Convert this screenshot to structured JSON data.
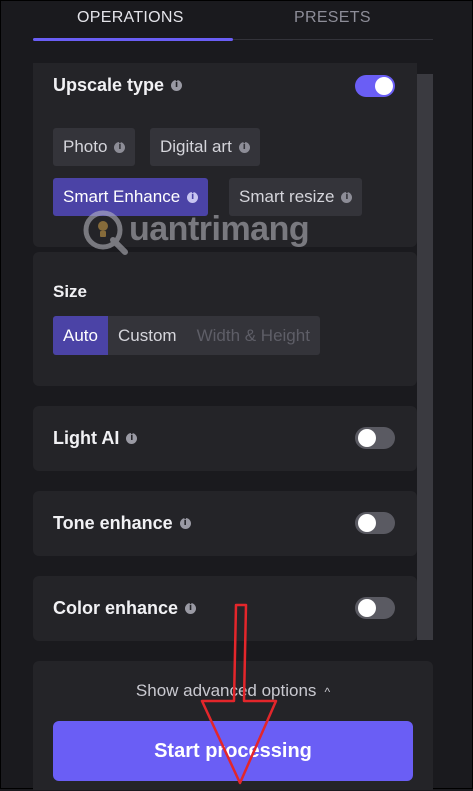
{
  "tabs": [
    {
      "label": "OPERATIONS",
      "active": true
    },
    {
      "label": "PRESETS",
      "active": false
    }
  ],
  "upscale": {
    "title": "Upscale type",
    "enabled": true,
    "types": [
      {
        "label": "Photo",
        "active": false
      },
      {
        "label": "Digital art",
        "active": false
      },
      {
        "label": "Smart Enhance",
        "active": true
      },
      {
        "label": "Smart resize",
        "active": false
      }
    ]
  },
  "size": {
    "title": "Size",
    "options": [
      {
        "label": "Auto",
        "active": true
      },
      {
        "label": "Custom",
        "active": false
      },
      {
        "label": "Width & Height",
        "disabled": true
      }
    ]
  },
  "toggles": {
    "light_ai": {
      "label": "Light AI",
      "enabled": false
    },
    "tone_enhance": {
      "label": "Tone enhance",
      "enabled": false
    },
    "color_enhance": {
      "label": "Color enhance",
      "enabled": false
    }
  },
  "footer": {
    "advanced_label": "Show advanced options",
    "start_label": "Start processing"
  },
  "watermark": {
    "text": "uantrimang"
  },
  "colors": {
    "accent": "#6a5ef5",
    "active_chip": "#4b43a6",
    "panel": "#242428",
    "annotation_arrow": "#e3262b"
  },
  "icons": {
    "info": "info-icon",
    "caret": "chevron-up-icon",
    "watermark_logo": "quantrimang-logo"
  }
}
